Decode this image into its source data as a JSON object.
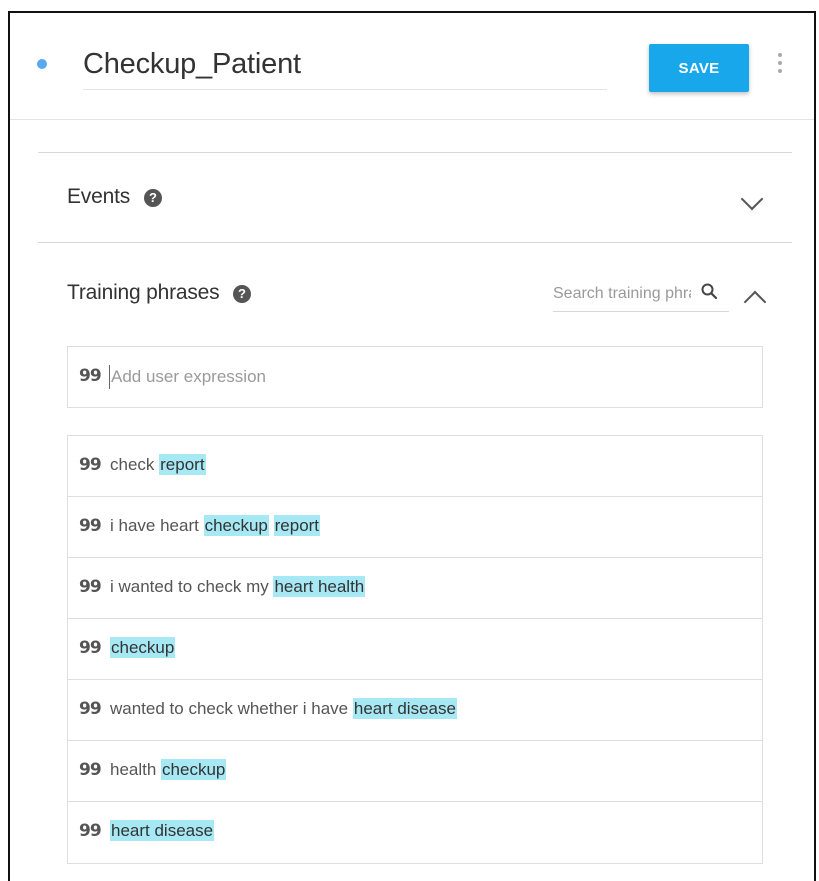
{
  "intent": {
    "title": "Checkup_Patient",
    "save_label": "SAVE"
  },
  "events": {
    "title": "Events"
  },
  "training": {
    "title": "Training phrases",
    "search_placeholder": "Search training phra",
    "add_placeholder": "Add user expression",
    "quote_glyph": "99",
    "phrases": [
      {
        "segments": [
          {
            "text": "check ",
            "hl": false
          },
          {
            "text": "report",
            "hl": true
          }
        ]
      },
      {
        "segments": [
          {
            "text": "i have heart ",
            "hl": false
          },
          {
            "text": "checkup",
            "hl": true
          },
          {
            "text": " ",
            "hl": false
          },
          {
            "text": "report",
            "hl": true
          }
        ]
      },
      {
        "segments": [
          {
            "text": "i wanted to check my ",
            "hl": false
          },
          {
            "text": "heart health",
            "hl": true
          }
        ]
      },
      {
        "segments": [
          {
            "text": "checkup",
            "hl": true
          }
        ]
      },
      {
        "segments": [
          {
            "text": "wanted to check whether i have ",
            "hl": false
          },
          {
            "text": "heart disease",
            "hl": true
          }
        ]
      },
      {
        "segments": [
          {
            "text": "health ",
            "hl": false
          },
          {
            "text": "checkup",
            "hl": true
          }
        ]
      },
      {
        "segments": [
          {
            "text": "heart disease",
            "hl": true
          }
        ]
      }
    ]
  },
  "icons": {
    "help": "?",
    "more": "more-vert-icon",
    "search": "search-icon"
  },
  "colors": {
    "accent": "#19a7ec",
    "highlight": "#a6e8f4",
    "dot": "#58a9f2"
  }
}
